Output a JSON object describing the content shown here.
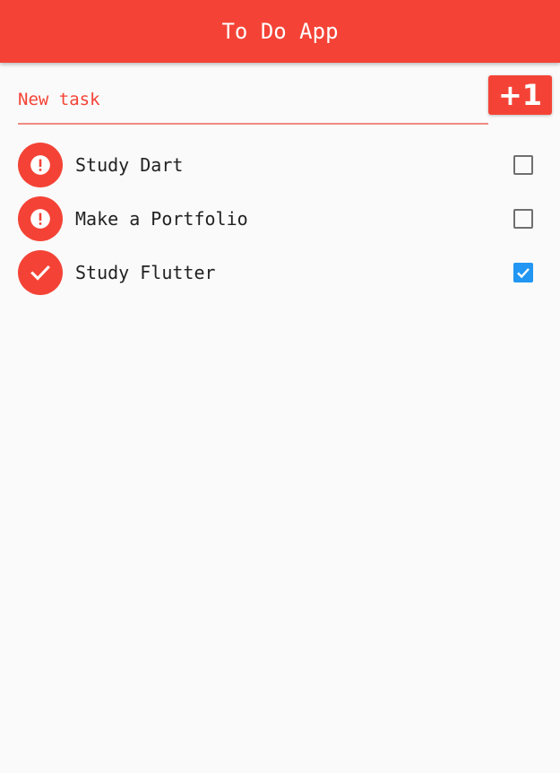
{
  "app_bar": {
    "title": "To Do App",
    "color": "#f44336"
  },
  "new_task": {
    "value": "",
    "placeholder": "New task",
    "add_label": "+1"
  },
  "tasks": [
    {
      "label": "Study Dart",
      "done": false,
      "status_icon": "exclamation-icon"
    },
    {
      "label": "Make a Portfolio",
      "done": false,
      "status_icon": "exclamation-icon"
    },
    {
      "label": "Study Flutter",
      "done": true,
      "status_icon": "check-icon"
    }
  ],
  "colors": {
    "accent": "#f44336",
    "checkbox_checked": "#2196f3",
    "checkbox_border": "#6f6f6f"
  }
}
